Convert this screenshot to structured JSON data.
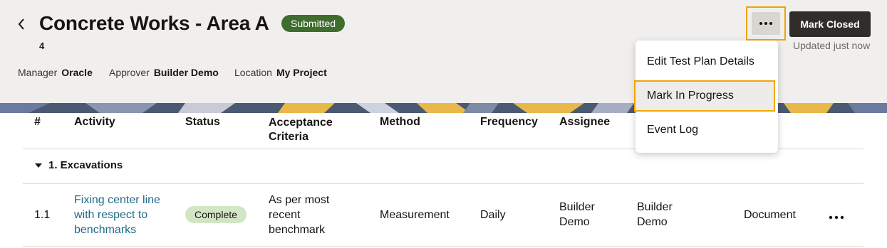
{
  "header": {
    "title": "Concrete Works - Area A",
    "status": "Submitted",
    "id": "4",
    "meta": [
      {
        "label": "Manager",
        "value": "Oracle"
      },
      {
        "label": "Approver",
        "value": "Builder Demo"
      },
      {
        "label": "Location",
        "value": "My Project"
      }
    ],
    "more_button_icon": "ellipsis-icon",
    "primary_action": "Mark Closed",
    "updated": "Updated just now"
  },
  "menu": {
    "items": [
      {
        "label": "Edit Test Plan Details"
      },
      {
        "label": "Mark In Progress",
        "highlighted": true
      },
      {
        "label": "Event Log"
      }
    ]
  },
  "table": {
    "columns": [
      "#",
      "Activity",
      "Status",
      "Acceptance Criteria",
      "Method",
      "Frequency",
      "Assignee"
    ],
    "groups": [
      {
        "label": "1. Excavations",
        "rows": [
          {
            "num": "1.1",
            "activity": "Fixing center line with respect to benchmarks",
            "status": "Complete",
            "criteria": "As per most recent benchmark",
            "method": "Measurement",
            "frequency": "Daily",
            "assignee": "Builder Demo",
            "col8": "Builder Demo",
            "col9": "Document"
          }
        ]
      }
    ]
  },
  "colors": {
    "accent_highlight": "#f0a500",
    "status_submitted": "#3f6d2e",
    "status_complete": "#d2e6c4",
    "link": "#1f6b86",
    "primary_button": "#312d2a"
  }
}
